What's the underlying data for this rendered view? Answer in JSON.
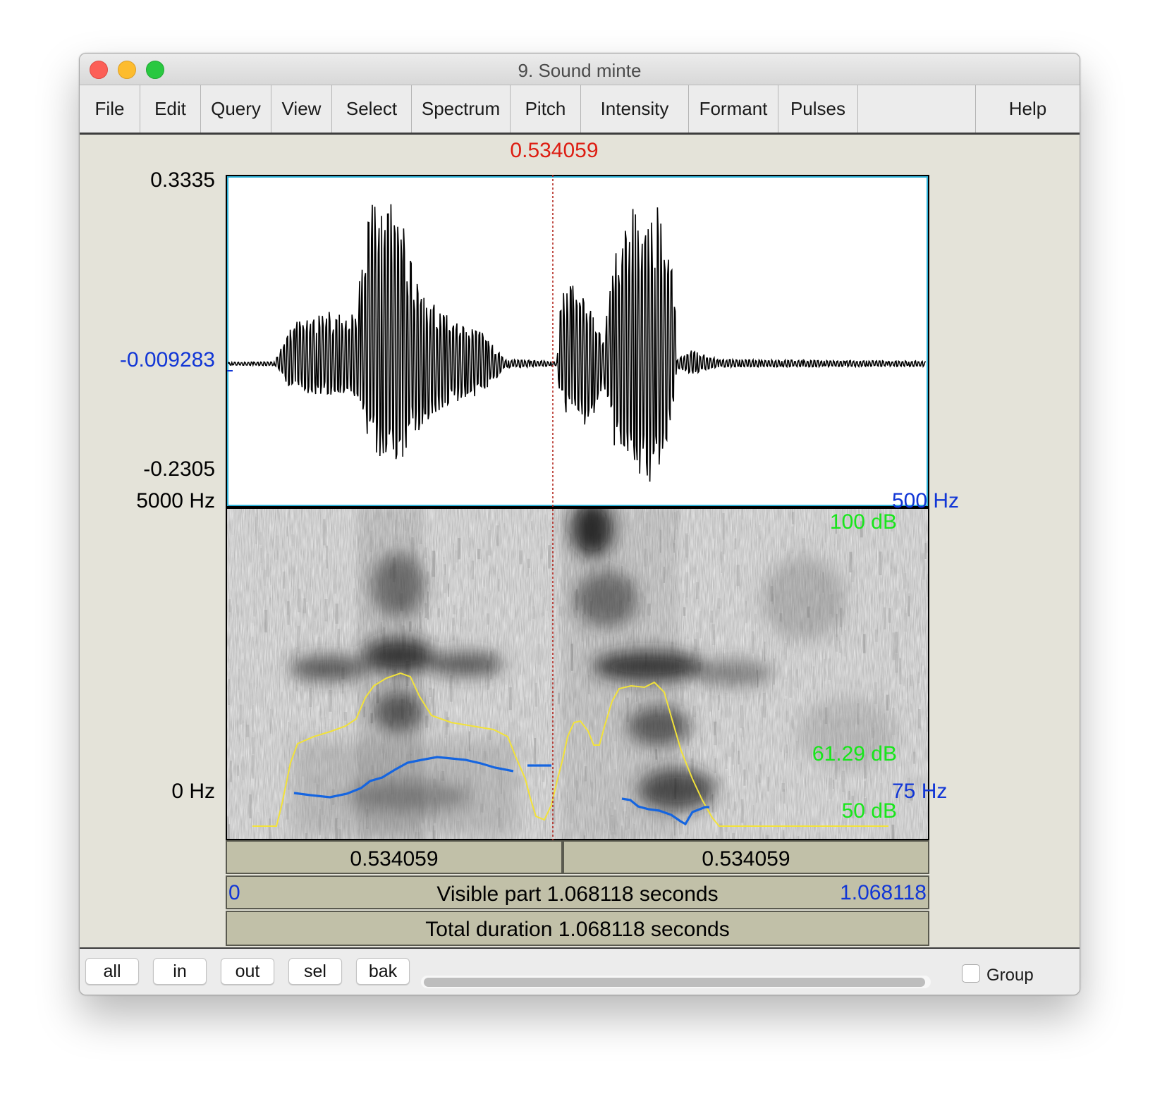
{
  "window": {
    "title": "9. Sound minte"
  },
  "menu": [
    "File",
    "Edit",
    "Query",
    "View",
    "Select",
    "Spectrum",
    "Pitch",
    "Intensity",
    "Formant",
    "Pulses",
    "Help"
  ],
  "cursor_time": "0.534059",
  "waveform": {
    "max_label": "0.3335",
    "mid_label": "-0.009283",
    "min_label": "-0.2305"
  },
  "spectrogram": {
    "freq_max_label": "5000 Hz",
    "freq_min_label": "0 Hz",
    "intensity_max_label": "100 dB",
    "intensity_cursor_label": "61.29 dB",
    "intensity_min_label": "50 dB",
    "pitch_max_label": "500 Hz",
    "pitch_min_label": "75 Hz"
  },
  "bars": {
    "left_segment": "0.534059",
    "right_segment": "0.534059",
    "visible_start": "0",
    "visible_label": "Visible part 1.068118 seconds",
    "visible_end": "1.068118",
    "total_label": "Total duration 1.068118 seconds"
  },
  "buttons": [
    "all",
    "in",
    "out",
    "sel",
    "bak"
  ],
  "group_label": "Group",
  "colors": {
    "cursor": "#dd1d12",
    "pitch": "#1565e0",
    "intensity": "#f2e23a",
    "axis_blue": "#1136d6",
    "db_green": "#17e61a"
  }
}
